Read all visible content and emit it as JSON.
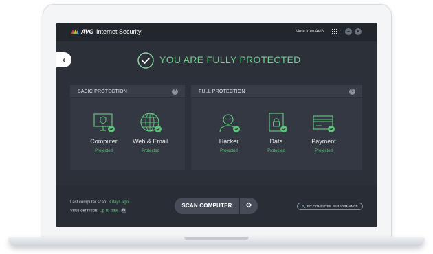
{
  "app": {
    "brand": "AVG",
    "product": "Internet Security",
    "more_from": "More from AVG"
  },
  "window_controls": {
    "minimize": "–",
    "close": "×"
  },
  "nav": {
    "back": "‹"
  },
  "status": {
    "headline": "YOU ARE FULLY PROTECTED"
  },
  "panels": {
    "basic": {
      "title": "BASIC PROTECTION",
      "help": "?",
      "items": [
        {
          "name": "Computer",
          "status": "Protected",
          "icon": "monitor-shield-icon"
        },
        {
          "name": "Web & Email",
          "status": "Protected",
          "icon": "globe-icon"
        }
      ]
    },
    "full": {
      "title": "FULL PROTECTION",
      "help": "?",
      "items": [
        {
          "name": "Hacker",
          "status": "Protected",
          "icon": "hacker-icon"
        },
        {
          "name": "Data",
          "status": "Protected",
          "icon": "lock-file-icon"
        },
        {
          "name": "Payment",
          "status": "Protected",
          "icon": "credit-card-icon"
        }
      ]
    }
  },
  "footer": {
    "last_scan_label": "Last computer scan:",
    "last_scan_value": "3 days ago",
    "virus_def_label": "Virus definition:",
    "virus_def_value": "Up to date",
    "scan_button": "SCAN COMPUTER",
    "fix_button": "FIX COMPUTER PERFORMANCE"
  },
  "colors": {
    "accent_green": "#5fc27d",
    "headline_green": "#6ed08a",
    "screen_bg": "#2c3039",
    "panel_bg": "#333842"
  }
}
